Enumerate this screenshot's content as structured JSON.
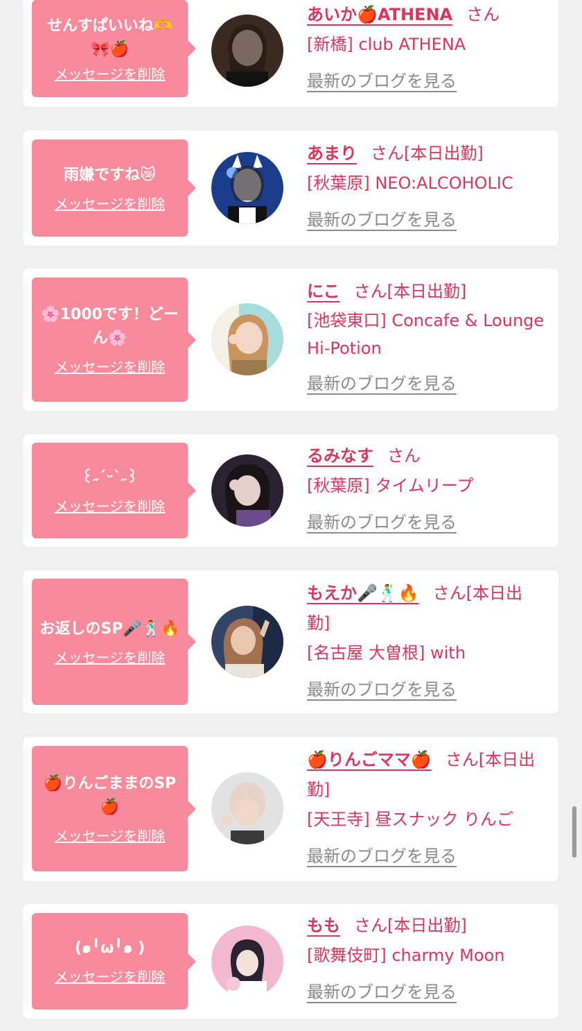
{
  "cards": [
    {
      "message": "せんすぱいいね🫶\n🎀🍎",
      "delete_label": "メッセージを削除",
      "name": "あいか🍎ATHENA",
      "honorific": "さん",
      "status": "",
      "shop": "[新橋] club ATHENA",
      "blog_label": "最新のブログを見る",
      "avatar_colors": [
        "#3a2a20",
        "#e9d2c3"
      ]
    },
    {
      "message": "雨嫌ですね😿",
      "delete_label": "メッセージを削除",
      "name": "あまり",
      "honorific": "さん",
      "status": "[本日出勤]",
      "shop": "[秋葉原] NEO:ALCOHOLIC",
      "blog_label": "最新のブログを見る",
      "avatar_colors": [
        "#1b3d8c",
        "#f1e6ea"
      ]
    },
    {
      "message": "🌸1000です！どーん🌸",
      "delete_label": "メッセージを削除",
      "name": "にこ",
      "honorific": "さん",
      "status": "[本日出勤]",
      "shop": "[池袋東口] Concafe & Lounge Hi-Potion",
      "blog_label": "最新のブログを見る",
      "avatar_colors": [
        "#a9dcdc",
        "#e8b88f"
      ]
    },
    {
      "message": "꒰˶ˊᵕˋ˶꒱",
      "delete_label": "メッセージを削除",
      "name": "るみなす",
      "honorific": "さん",
      "status": "",
      "shop": "[秋葉原] タイムリープ",
      "blog_label": "最新のブログを見る",
      "avatar_colors": [
        "#2a2230",
        "#e6cfc8"
      ]
    },
    {
      "message": "お返しのSP🎤🕺🔥",
      "delete_label": "メッセージを削除",
      "name": "もえか🎤🕺🔥",
      "honorific": "さん",
      "status": "[本日出勤]",
      "shop": "[名古屋 大曽根] with",
      "blog_label": "最新のブログを見る",
      "avatar_colors": [
        "#334466",
        "#e8c6b0"
      ]
    },
    {
      "message": "🍎りんごままのSP🍎",
      "delete_label": "メッセージを削除",
      "name": "🍎りんごママ🍎",
      "honorific": "さん",
      "status": "[本日出勤]",
      "shop": "[天王寺] 昼スナック りんご",
      "blog_label": "最新のブログを見る",
      "avatar_colors": [
        "#d8d8d8",
        "#f0d8c8"
      ]
    },
    {
      "message": "(๑╹ω╹๑ )",
      "delete_label": "メッセージを削除",
      "name": "もも",
      "honorific": "さん",
      "status": "[本日出勤]",
      "shop": "[歌舞伎町] charmy Moon",
      "blog_label": "最新のブログを見る",
      "avatar_colors": [
        "#f3b8cf",
        "#2a2230"
      ]
    }
  ]
}
